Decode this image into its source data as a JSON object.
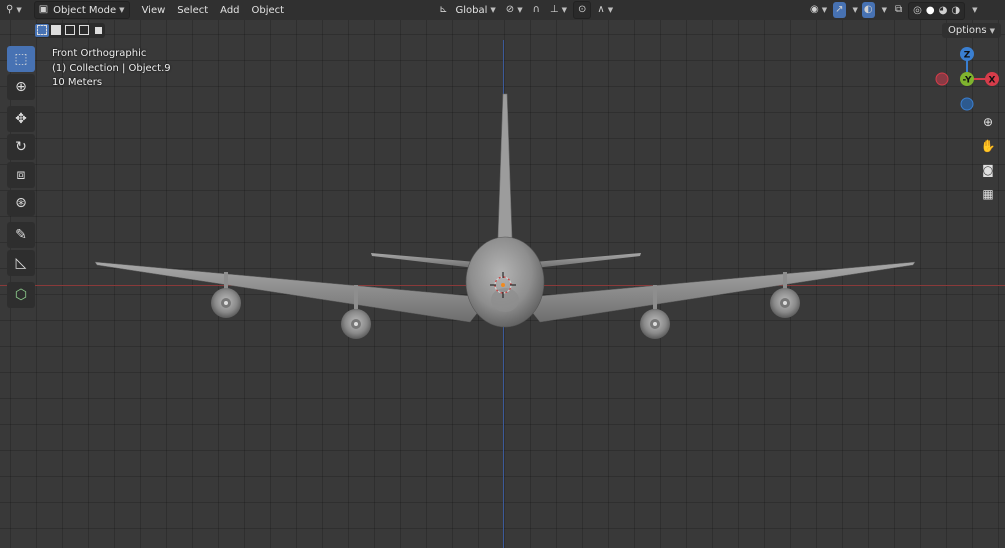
{
  "header": {
    "editor_icon": "editor-type-icon",
    "mode_label": "Object Mode",
    "menus": [
      "View",
      "Select",
      "Add",
      "Object"
    ],
    "orientation_label": "Global"
  },
  "subheader": {
    "options_label": "Options"
  },
  "viewport_info": {
    "view_name": "Front Orthographic",
    "collection": "(1) Collection | Object.9",
    "scale": "10 Meters"
  },
  "gizmo": {
    "z_label": "Z",
    "y_label": "-Y",
    "x_label": "X",
    "colors": {
      "x": "#d63c4a",
      "y": "#7fb32e",
      "z": "#3a7fd1",
      "active": "#4772b3"
    }
  },
  "toolbar": {
    "tools": [
      "select-box-icon",
      "cursor-icon",
      "move-icon",
      "rotate-icon",
      "scale-icon",
      "transform-icon",
      "annotate-icon",
      "measure-icon",
      "add-cube-icon"
    ]
  }
}
